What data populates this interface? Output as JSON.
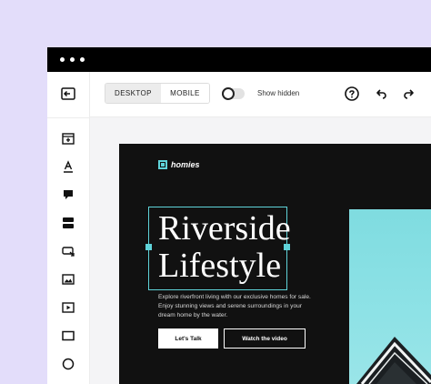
{
  "editor": {
    "view_modes": [
      "DESKTOP",
      "MOBILE"
    ],
    "active_view": "DESKTOP",
    "show_hidden_label": "Show hidden",
    "show_hidden_on": false
  },
  "site": {
    "logo_text": "homies",
    "hero_title_line1": "Riverside",
    "hero_title_line2": "Lifestyle",
    "hero_description": "Explore riverfront living with our exclusive homes for sale. Enjoy stunning views and serene surroundings in your dream home by the water.",
    "primary_cta": "Let's Talk",
    "secondary_cta": "Watch the video"
  },
  "colors": {
    "background": "#e3ddfa",
    "accent": "#5fd3d9",
    "page_background": "#111111"
  }
}
